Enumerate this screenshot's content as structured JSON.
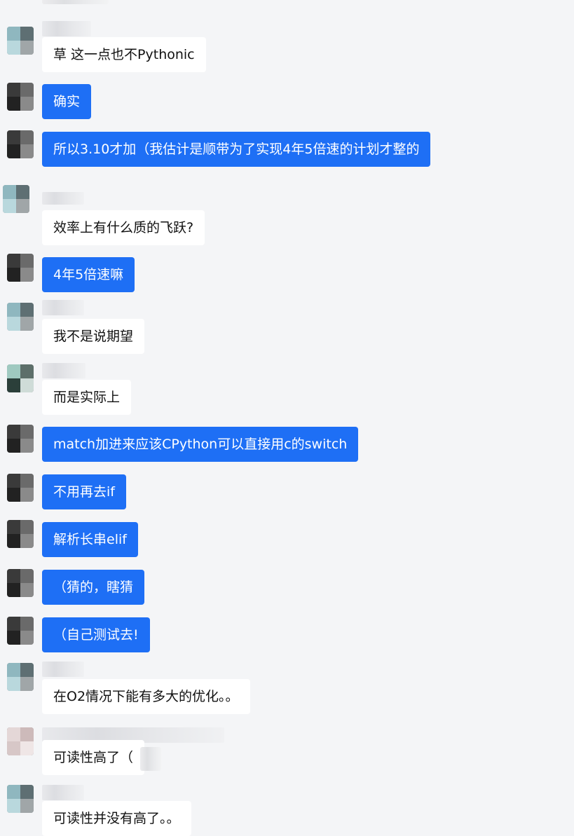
{
  "messages": [
    {
      "sender": "other",
      "text": "草 这一点也不Pythonic"
    },
    {
      "sender": "self",
      "text": "确实"
    },
    {
      "sender": "self",
      "text": "所以3.10才加（我估计是顺带为了实现4年5倍速的计划才整的"
    },
    {
      "sender": "other",
      "text": "效率上有什么质的飞跃?"
    },
    {
      "sender": "self",
      "text": "4年5倍速嘛"
    },
    {
      "sender": "other",
      "text": "我不是说期望"
    },
    {
      "sender": "other",
      "text": "而是实际上"
    },
    {
      "sender": "self",
      "text": "match加进来应该CPython可以直接用c的switch"
    },
    {
      "sender": "self",
      "text": "不用再去if"
    },
    {
      "sender": "self",
      "text": "解析长串elif"
    },
    {
      "sender": "self",
      "text": "（猜的，瞎猜"
    },
    {
      "sender": "self",
      "text": "（自己测试去!"
    },
    {
      "sender": "other",
      "text": "在O2情况下能有多大的优化。。"
    },
    {
      "sender": "other",
      "text": "可读性高了（"
    },
    {
      "sender": "other",
      "text": "可读性并没有高了。。"
    }
  ],
  "colors": {
    "self_bubble": "#1e6ff5",
    "other_bubble": "#ffffff",
    "background": "#f4f5f7"
  }
}
